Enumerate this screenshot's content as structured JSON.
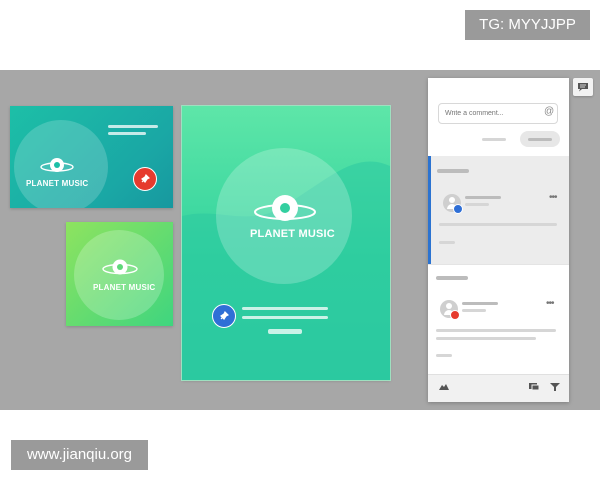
{
  "overlay": {
    "tag": "TG: MYYJJPP",
    "watermark": "www.jianqiu.org"
  },
  "artboards": [
    {
      "logo": "PLANET MUSIC",
      "pin_color": "#e63b2e"
    },
    {
      "logo": "PLANET MUSIC"
    },
    {
      "logo": "PLANET MUSIC",
      "pin_color": "#2f6fd6"
    }
  ],
  "comments_panel": {
    "input_placeholder": "Write a comment..."
  },
  "colors": {
    "canvas": "#a7a7a7",
    "selected_thread_accent": "#2b73d1",
    "blue_badge": "#2f6fd6",
    "red_badge": "#e63b2e"
  }
}
